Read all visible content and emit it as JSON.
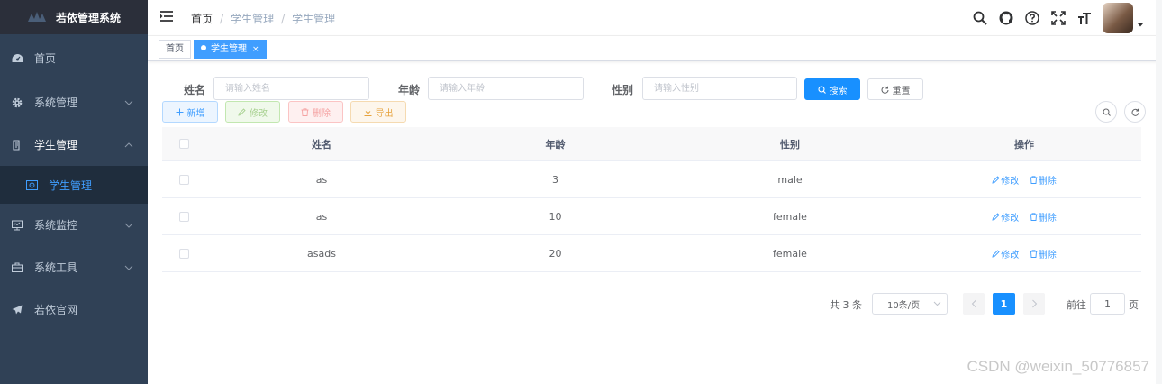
{
  "sidebar": {
    "logo_text": "若依管理系统",
    "items": [
      {
        "label": "首页",
        "icon": "dashboard-icon"
      },
      {
        "label": "系统管理",
        "icon": "gear-icon"
      },
      {
        "label": "学生管理",
        "icon": "document-icon"
      },
      {
        "label": "学生管理",
        "icon": "student-icon"
      },
      {
        "label": "系统监控",
        "icon": "monitor-icon"
      },
      {
        "label": "系统工具",
        "icon": "toolbox-icon"
      },
      {
        "label": "若依官网",
        "icon": "send-icon"
      }
    ]
  },
  "navbar": {
    "breadcrumb": [
      "首页",
      "学生管理",
      "学生管理"
    ],
    "separator": "/"
  },
  "tags": {
    "home": "首页",
    "active": "学生管理",
    "close": "×"
  },
  "search": {
    "name_label": "姓名",
    "name_placeholder": "请输入姓名",
    "age_label": "年龄",
    "age_placeholder": "请输入年龄",
    "gender_label": "性别",
    "gender_placeholder": "请输入性别",
    "search_button": "搜索",
    "reset_button": "重置"
  },
  "toolbar": {
    "add": "新增",
    "edit": "修改",
    "delete": "删除",
    "export": "导出"
  },
  "table": {
    "columns": [
      "姓名",
      "年龄",
      "性别",
      "操作"
    ],
    "rows": [
      {
        "name": "as",
        "age": "3",
        "gender": "male"
      },
      {
        "name": "as",
        "age": "10",
        "gender": "female"
      },
      {
        "name": "asads",
        "age": "20",
        "gender": "female"
      }
    ],
    "edit_label": "修改",
    "delete_label": "删除"
  },
  "pagination": {
    "total": "共 3 条",
    "page_size": "10条/页",
    "current_page": "1",
    "goto_label": "前往",
    "goto_value": "1",
    "page_suffix": "页"
  },
  "watermark": "CSDN @weixin_50776857",
  "colors": {
    "sidebar_bg": "#304156",
    "primary": "#1890ff",
    "link": "#409eff"
  }
}
